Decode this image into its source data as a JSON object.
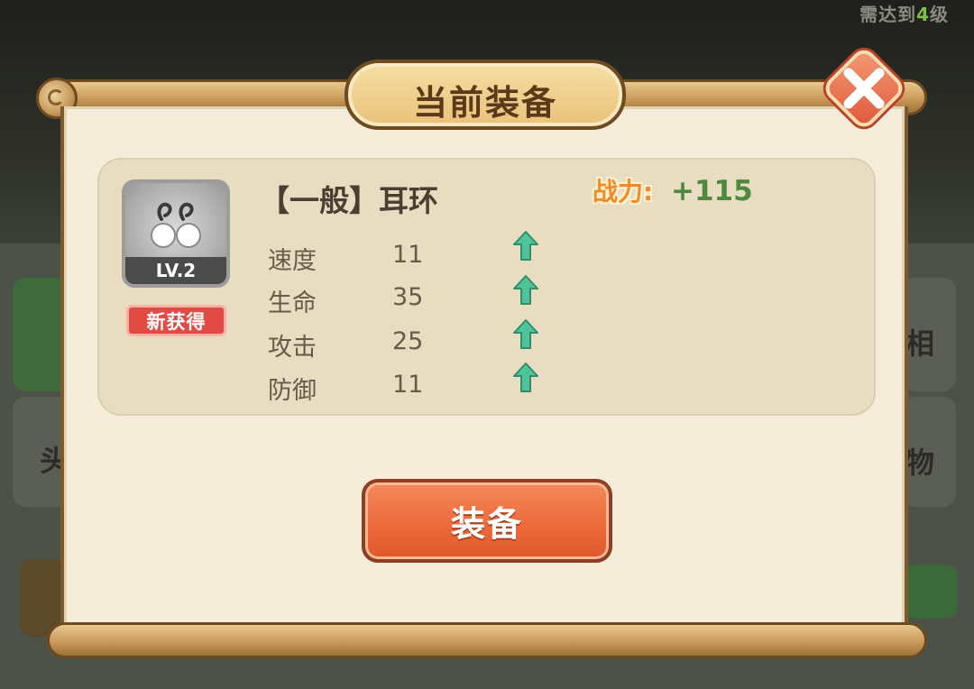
{
  "background": {
    "hint_prefix": "需达到",
    "hint_level": "4",
    "hint_suffix": "级",
    "side_chars": [
      "头",
      "相",
      "物"
    ]
  },
  "dialog": {
    "title": "当前装备",
    "close_icon": "close-icon"
  },
  "item": {
    "icon": "earring-icon",
    "level": "LV.2",
    "new_tag": "新获得",
    "name": "【一般】耳环",
    "power_label": "战力:",
    "power_value": "+115",
    "stats": [
      {
        "name": "速度",
        "value": "11",
        "trend": "up"
      },
      {
        "name": "生命",
        "value": "35",
        "trend": "up"
      },
      {
        "name": "攻击",
        "value": "25",
        "trend": "up"
      },
      {
        "name": "防御",
        "value": "11",
        "trend": "up"
      }
    ]
  },
  "actions": {
    "equip_label": "装备"
  },
  "colors": {
    "accent_orange": "#ec6a3c",
    "power_green": "#4d8a3d",
    "arrow_green": "#4fc39a",
    "new_tag_red": "#e24b44"
  }
}
